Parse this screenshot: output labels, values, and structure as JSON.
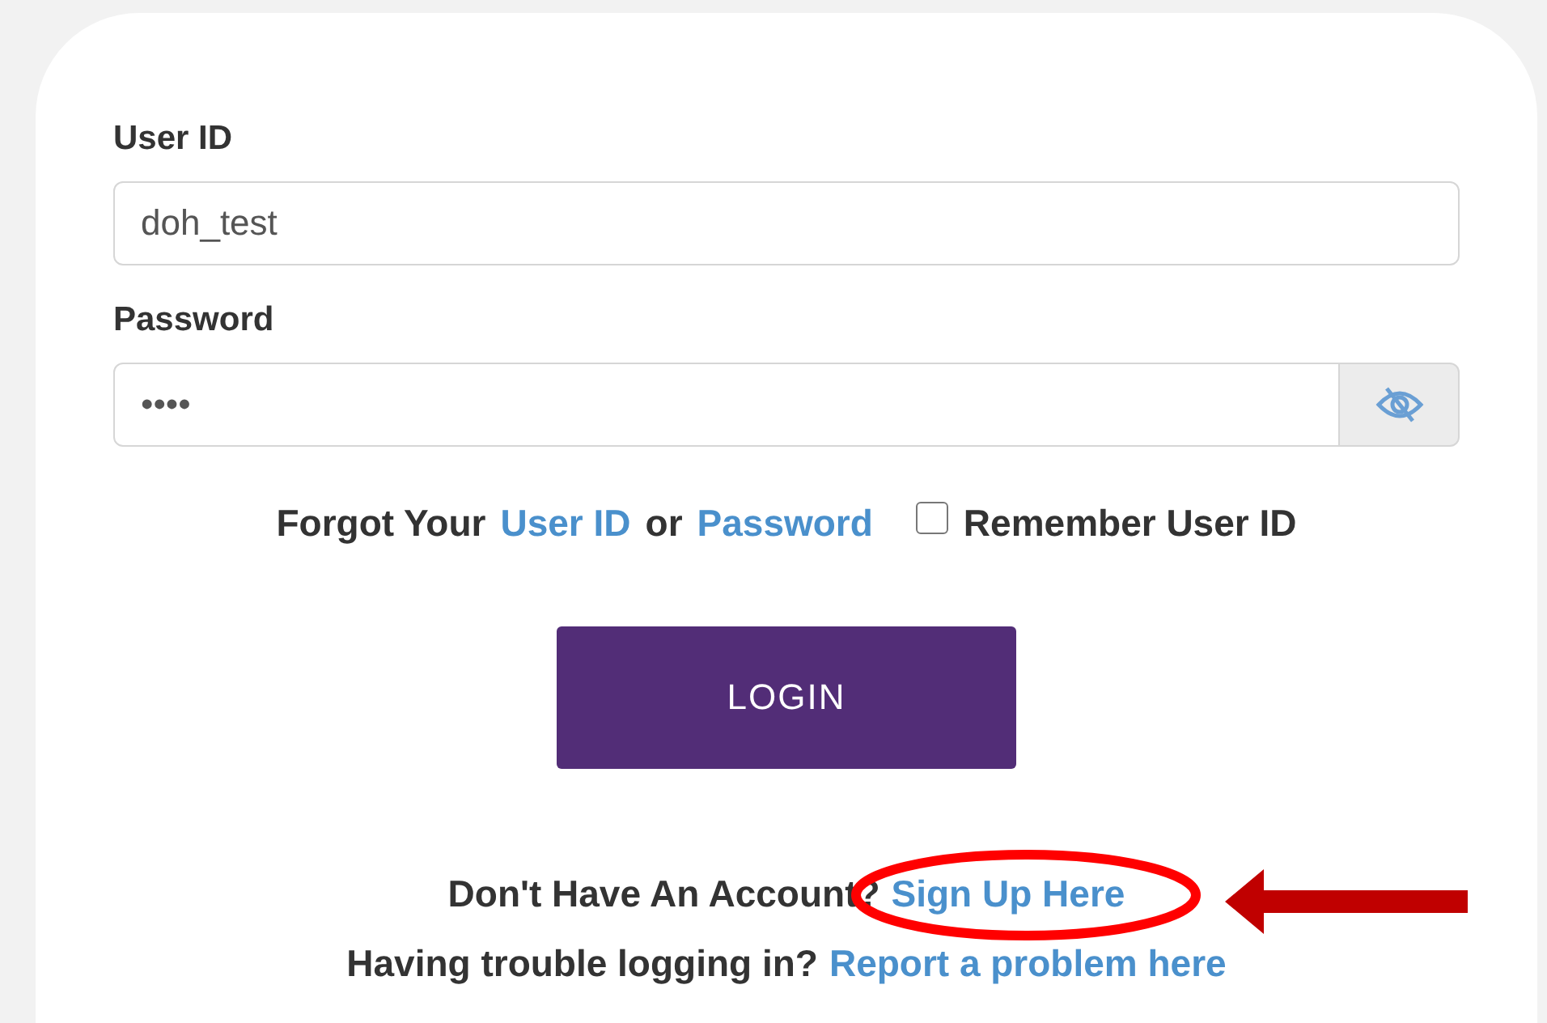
{
  "form": {
    "user_id": {
      "label": "User ID",
      "value": "doh_test"
    },
    "password": {
      "label": "Password",
      "value": "••••",
      "visible": false
    },
    "forgot": {
      "prefix": "Forgot Your",
      "link_1": "User ID",
      "joiner": "or",
      "link_2": "Password"
    },
    "remember": {
      "label": "Remember User ID",
      "checked": false
    },
    "login_button": "LOGIN",
    "signup": {
      "text": "Don't Have An Account?",
      "link": "Sign Up Here"
    },
    "trouble": {
      "text": "Having trouble logging in?",
      "link": "Report a problem here"
    }
  },
  "annotation": {
    "highlight": true,
    "arrow": true
  }
}
